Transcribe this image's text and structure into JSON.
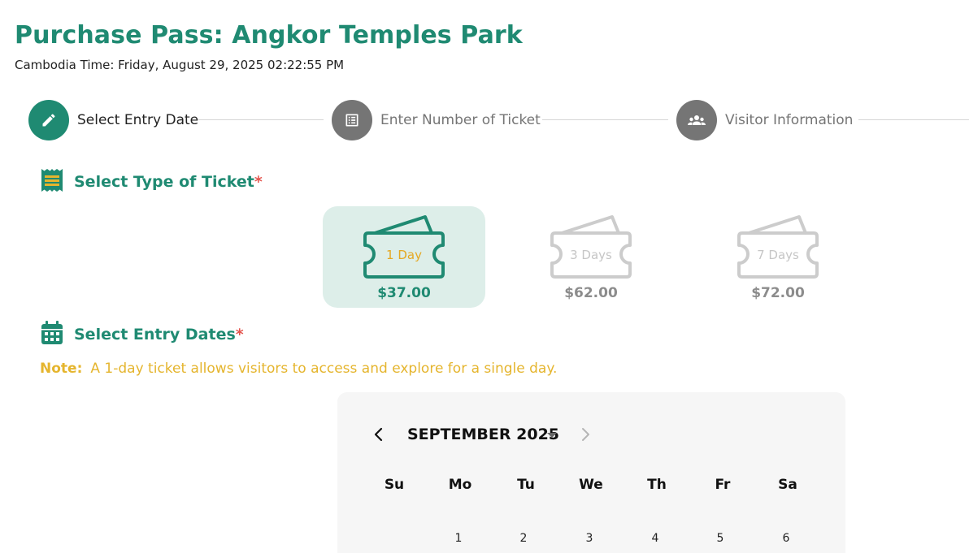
{
  "header": {
    "title": "Purchase Pass: Angkor Temples Park",
    "time_label": "Cambodia Time: Friday, August 29, 2025 02:22:55 PM"
  },
  "stepper": {
    "steps": [
      {
        "label": "Select Entry Date",
        "icon": "pencil-icon",
        "state": "active"
      },
      {
        "label": "Enter Number of Ticket",
        "icon": "list-icon",
        "state": "inactive"
      },
      {
        "label": "Visitor Information",
        "icon": "group-icon",
        "state": "inactive"
      }
    ]
  },
  "ticket_section": {
    "title": "Select Type of Ticket",
    "required_mark": "*",
    "icon": "ticket-list-icon",
    "options": [
      {
        "name": "1 Day",
        "price": "$37.00",
        "selected": true
      },
      {
        "name": "3 Days",
        "price": "$62.00",
        "selected": false
      },
      {
        "name": "7 Days",
        "price": "$72.00",
        "selected": false
      }
    ]
  },
  "dates_section": {
    "title": "Select Entry Dates",
    "required_mark": "*",
    "icon": "calendar-icon",
    "note_label": "Note:",
    "note_text": "A 1-day ticket allows visitors to access and explore for a single day."
  },
  "calendar": {
    "month_label": "SEPTEMBER 2025",
    "weekdays": [
      "Su",
      "Mo",
      "Tu",
      "We",
      "Th",
      "Fr",
      "Sa"
    ],
    "first_week": [
      "",
      "1",
      "2",
      "3",
      "4",
      "5",
      "6"
    ],
    "prev_icon": "chevron-left-icon",
    "next_icon": "chevron-right-icon"
  },
  "colors": {
    "brand": "#1f8a72",
    "accent": "#e5a823",
    "required": "#e4564f",
    "inactive": "#757575",
    "selected_bg": "#ddeee9"
  }
}
